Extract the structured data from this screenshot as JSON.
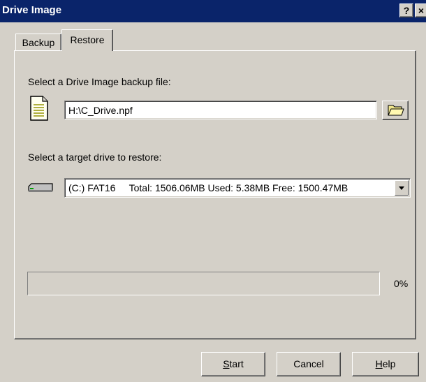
{
  "window": {
    "title": "Drive Image",
    "help_button": "?",
    "close_button": "×"
  },
  "tabs": [
    {
      "label": "Backup",
      "active": false
    },
    {
      "label": "Restore",
      "active": true
    }
  ],
  "restore": {
    "backup_file_label": "Select a Drive Image backup file:",
    "backup_file_value": "H:\\C_Drive.npf",
    "target_drive_label": "Select a target drive to restore:",
    "target_drive_value": "(C:) FAT16     Total: 1506.06MB Used: 5.38MB Free: 1500.47MB",
    "progress_percent": 0,
    "progress_text": "0%"
  },
  "buttons": {
    "start": "Start",
    "cancel": "Cancel",
    "help": "Help"
  },
  "icons": {
    "file": "document-icon",
    "browse": "open-folder-icon",
    "drive": "hard-drive-icon"
  }
}
